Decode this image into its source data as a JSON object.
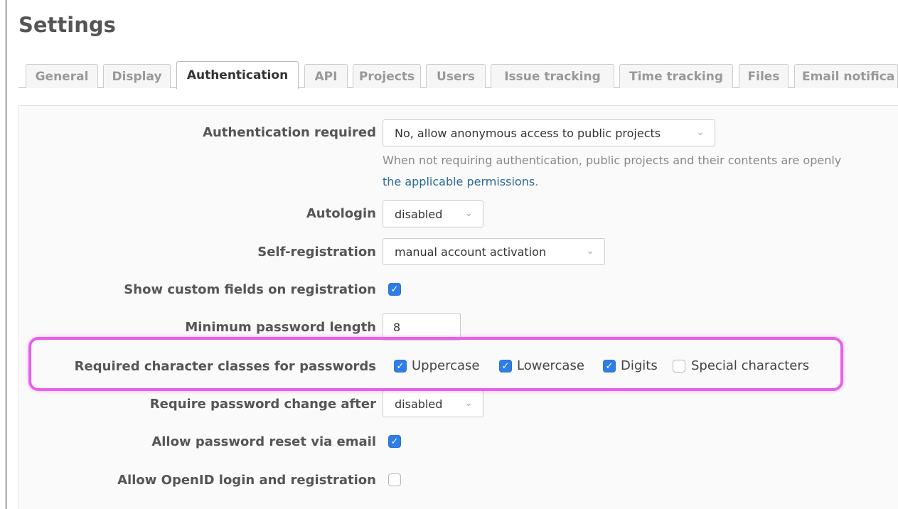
{
  "page": {
    "title": "Settings"
  },
  "tabs": [
    {
      "label": "General",
      "selected": false
    },
    {
      "label": "Display",
      "selected": false
    },
    {
      "label": "Authentication",
      "selected": true
    },
    {
      "label": "API",
      "selected": false
    },
    {
      "label": "Projects",
      "selected": false
    },
    {
      "label": "Users",
      "selected": false
    },
    {
      "label": "Issue tracking",
      "selected": false
    },
    {
      "label": "Time tracking",
      "selected": false
    },
    {
      "label": "Files",
      "selected": false
    },
    {
      "label": "Email notifica",
      "selected": false
    }
  ],
  "fields": {
    "auth_required": {
      "label": "Authentication required",
      "value": "No, allow anonymous access to public projects",
      "hint": "When not requiring authentication, public projects and their contents are openly",
      "hint_link": "the applicable permissions",
      "hint_end": "."
    },
    "autologin": {
      "label": "Autologin",
      "value": "disabled"
    },
    "self_registration": {
      "label": "Self-registration",
      "value": "manual account activation"
    },
    "custom_fields": {
      "label": "Show custom fields on registration",
      "checked": true
    },
    "min_password": {
      "label": "Minimum password length",
      "value": "8"
    },
    "char_classes": {
      "label": "Required character classes for passwords",
      "options": [
        {
          "label": "Uppercase",
          "checked": true
        },
        {
          "label": "Lowercase",
          "checked": true
        },
        {
          "label": "Digits",
          "checked": true
        },
        {
          "label": "Special characters",
          "checked": false
        }
      ]
    },
    "password_change": {
      "label": "Require password change after",
      "value": "disabled"
    },
    "password_reset": {
      "label": "Allow password reset via email",
      "checked": true
    },
    "openid": {
      "label": "Allow OpenID login and registration",
      "checked": false
    }
  },
  "icons": {
    "chevron": "chevron-down-icon",
    "check": "check-icon"
  },
  "colors": {
    "highlight": "#e95fe9",
    "checkbox_on": "#2f7ee6",
    "link": "#2a6b94"
  }
}
